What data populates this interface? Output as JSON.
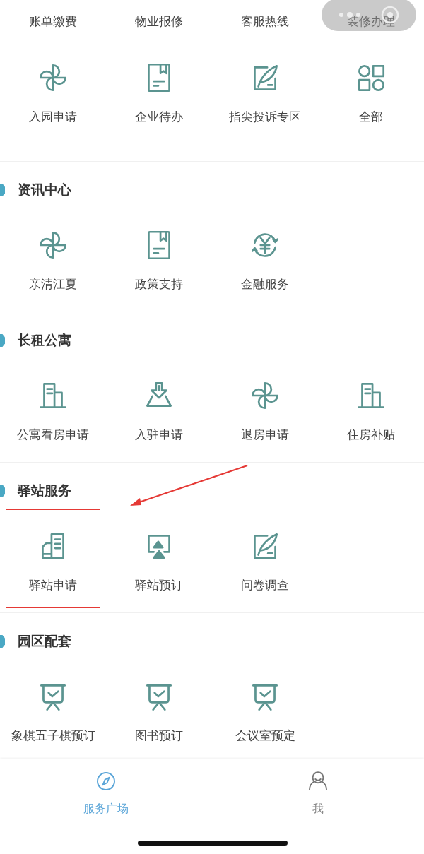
{
  "top_row": [
    {
      "label": "账单缴费"
    },
    {
      "label": "物业报修"
    },
    {
      "label": "客服热线"
    },
    {
      "label": "装修办理"
    }
  ],
  "main_row": [
    {
      "label": "入园申请",
      "kind": "pinwheel"
    },
    {
      "label": "企业待办",
      "kind": "document"
    },
    {
      "label": "指尖投诉专区",
      "kind": "quill"
    },
    {
      "label": "全部",
      "kind": "grid"
    }
  ],
  "sections": [
    {
      "title": "资讯中心",
      "items": [
        {
          "label": "亲清江夏",
          "kind": "pinwheel",
          "highlighted": false
        },
        {
          "label": "政策支持",
          "kind": "document",
          "highlighted": false
        },
        {
          "label": "金融服务",
          "kind": "yen",
          "highlighted": false
        }
      ]
    },
    {
      "title": "长租公寓",
      "items": [
        {
          "label": "公寓看房申请",
          "kind": "building",
          "highlighted": false
        },
        {
          "label": "入驻申请",
          "kind": "download",
          "highlighted": false
        },
        {
          "label": "退房申请",
          "kind": "pinwheel",
          "highlighted": false
        },
        {
          "label": "住房补贴",
          "kind": "building",
          "highlighted": false
        }
      ]
    },
    {
      "title": "驿站服务",
      "items": [
        {
          "label": "驿站申请",
          "kind": "tower",
          "highlighted": true
        },
        {
          "label": "驿站预订",
          "kind": "display",
          "highlighted": false
        },
        {
          "label": "问卷调查",
          "kind": "quill",
          "highlighted": false
        }
      ]
    },
    {
      "title": "园区配套",
      "items": [
        {
          "label": "象棋五子棋预订",
          "kind": "easel",
          "highlighted": false
        },
        {
          "label": "图书预订",
          "kind": "easel",
          "highlighted": false
        },
        {
          "label": "会议室预定",
          "kind": "easel",
          "highlighted": false
        }
      ]
    }
  ],
  "tab_bar": [
    {
      "label": "服务广场",
      "kind": "compass",
      "selected": true
    },
    {
      "label": "我",
      "kind": "person",
      "selected": false
    }
  ]
}
